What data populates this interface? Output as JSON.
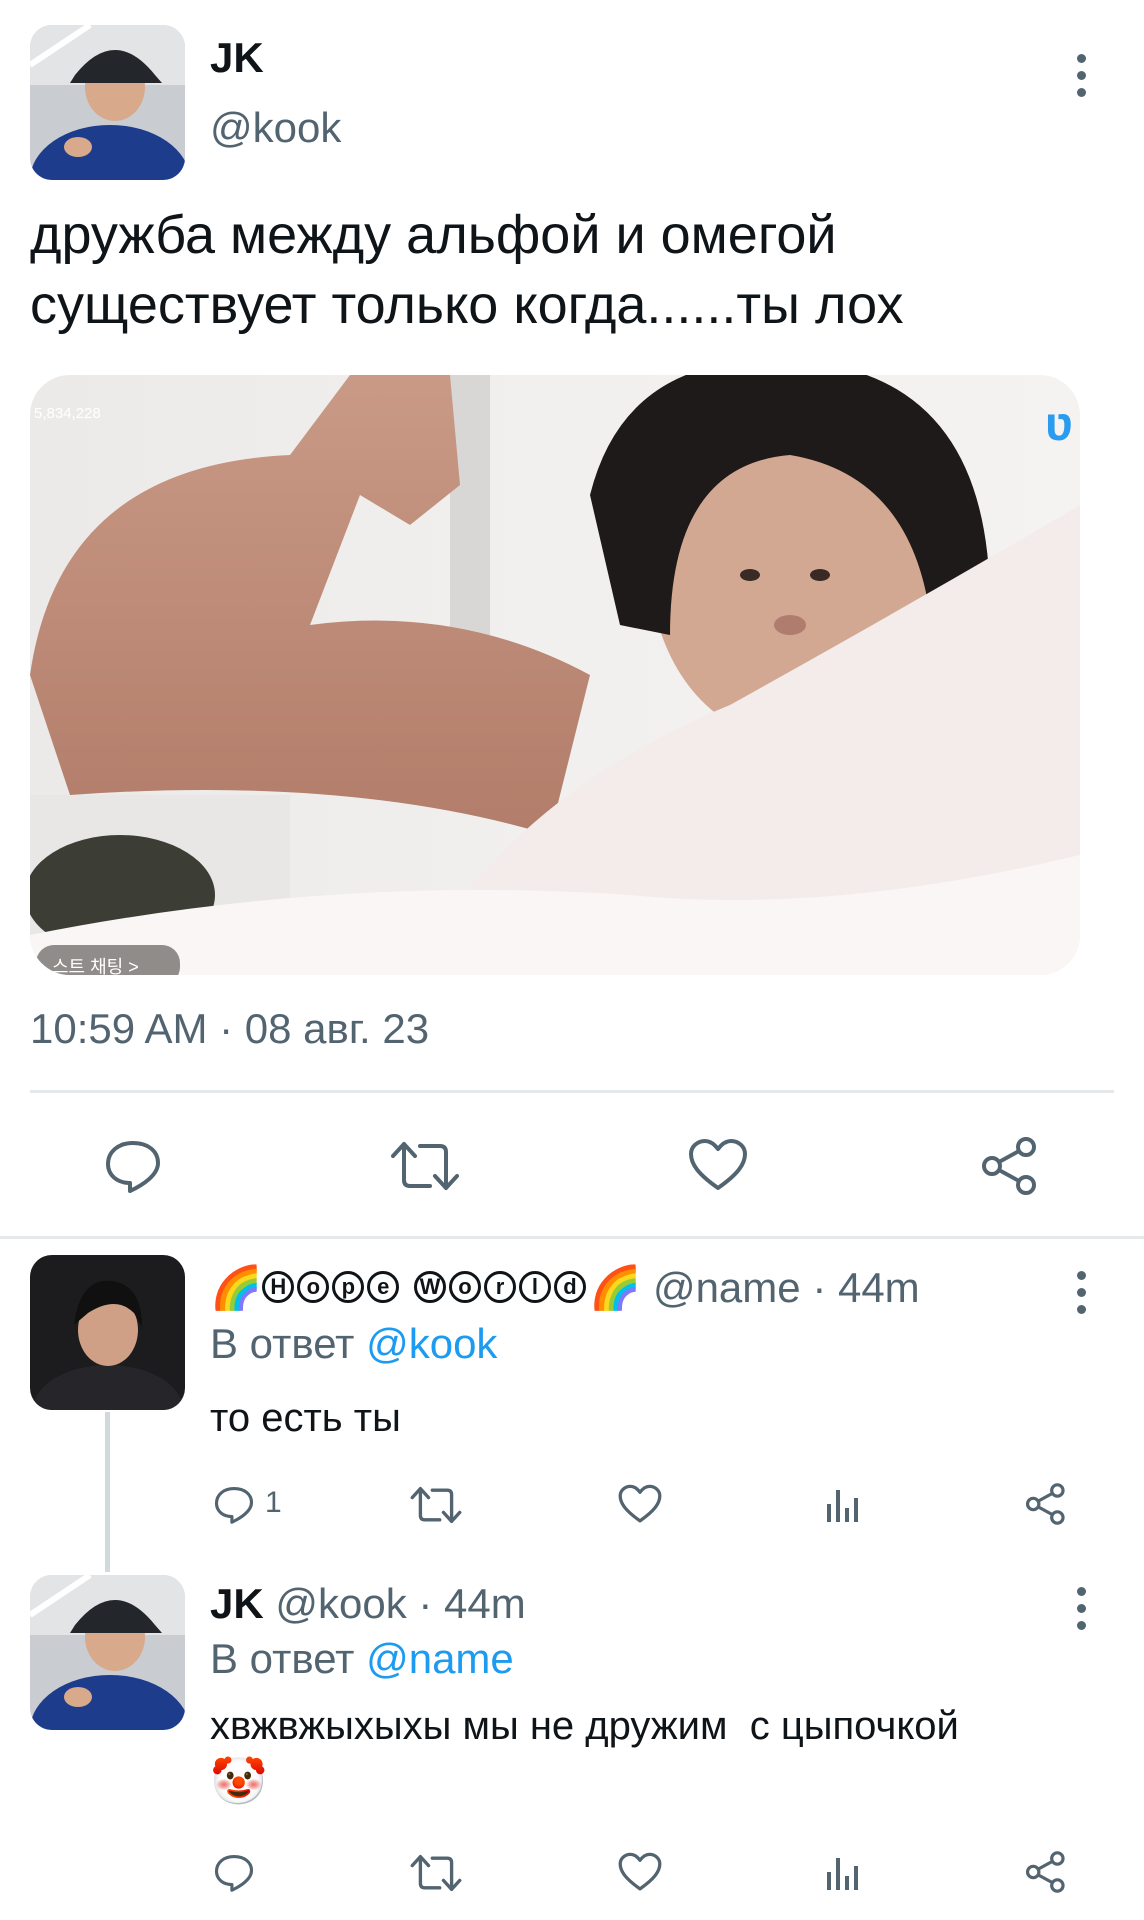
{
  "main_tweet": {
    "author_name": "JK",
    "author_handle": "@kook",
    "text_line1": "дружба между альфой и омегой",
    "text_line2": "существует только когда......ты лох",
    "image_overlay_counter": "5,834,228",
    "image_overlay_badge": "스트 채팅 >",
    "timestamp": "10:59 AM · 08 авг. 23",
    "avatar_icon": "user-avatar-bucket-hat",
    "actions": [
      "reply-icon",
      "retweet-icon",
      "like-icon",
      "share-icon"
    ]
  },
  "replies": [
    {
      "display_name_letters": [
        "H",
        "o",
        "p",
        "e"
      ],
      "display_name_letters2": [
        "W",
        "o",
        "r",
        "l",
        "d"
      ],
      "handle": "@name",
      "age": "· 44m",
      "reply_prefix": "В ответ",
      "reply_target": "@kook",
      "text": "то есть ты",
      "reply_count": "1"
    },
    {
      "display_name": "JK",
      "handle": "@kook",
      "age": "· 44m",
      "reply_prefix": "В ответ",
      "reply_target": "@name",
      "text": "хвжвжыхыхы мы не дружим  с цыпочкой",
      "reply_count": ""
    }
  ],
  "colors": {
    "text": "#0f1419",
    "secondary": "#536471",
    "link": "#1d9bf0",
    "divider": "#e6e9eb"
  }
}
